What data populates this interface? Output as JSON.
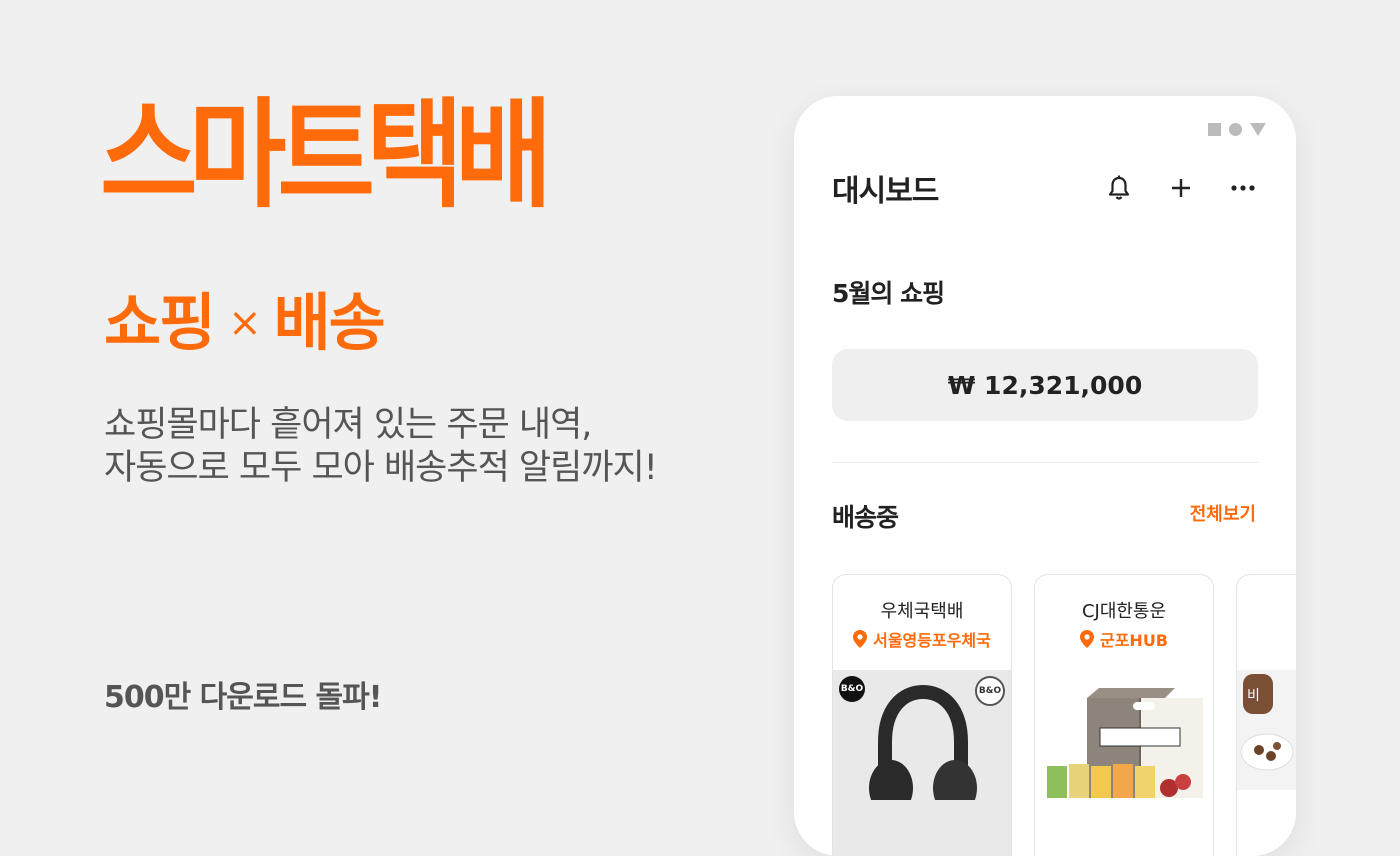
{
  "promo": {
    "logo": "스마트택배",
    "tagline_left": "쇼핑",
    "tagline_sep": "×",
    "tagline_right": "배송",
    "description_line1": "쇼핑몰마다 흩어져 있는 주문 내역,",
    "description_line2": "자동으로 모두 모아 배송추적 알림까지!",
    "downloads": "500만 다운로드 돌파!"
  },
  "colors": {
    "accent": "#ff6b0a",
    "background": "#f0f0f0"
  },
  "app": {
    "title": "대시보드",
    "header_icons": [
      "bell-icon",
      "plus-icon",
      "more-icon"
    ],
    "monthly_title": "5월의 쇼핑",
    "monthly_amount": "₩ 12,321,000",
    "shipping_title": "배송중",
    "see_all": "전체보기",
    "cards": [
      {
        "courier": "우체국택배",
        "location": "서울영등포우체국",
        "product": "headphones"
      },
      {
        "courier": "CJ대한통운",
        "location": "군포HUB",
        "product": "snack-box"
      },
      {
        "courier": "",
        "location": "",
        "product": "food"
      }
    ]
  }
}
